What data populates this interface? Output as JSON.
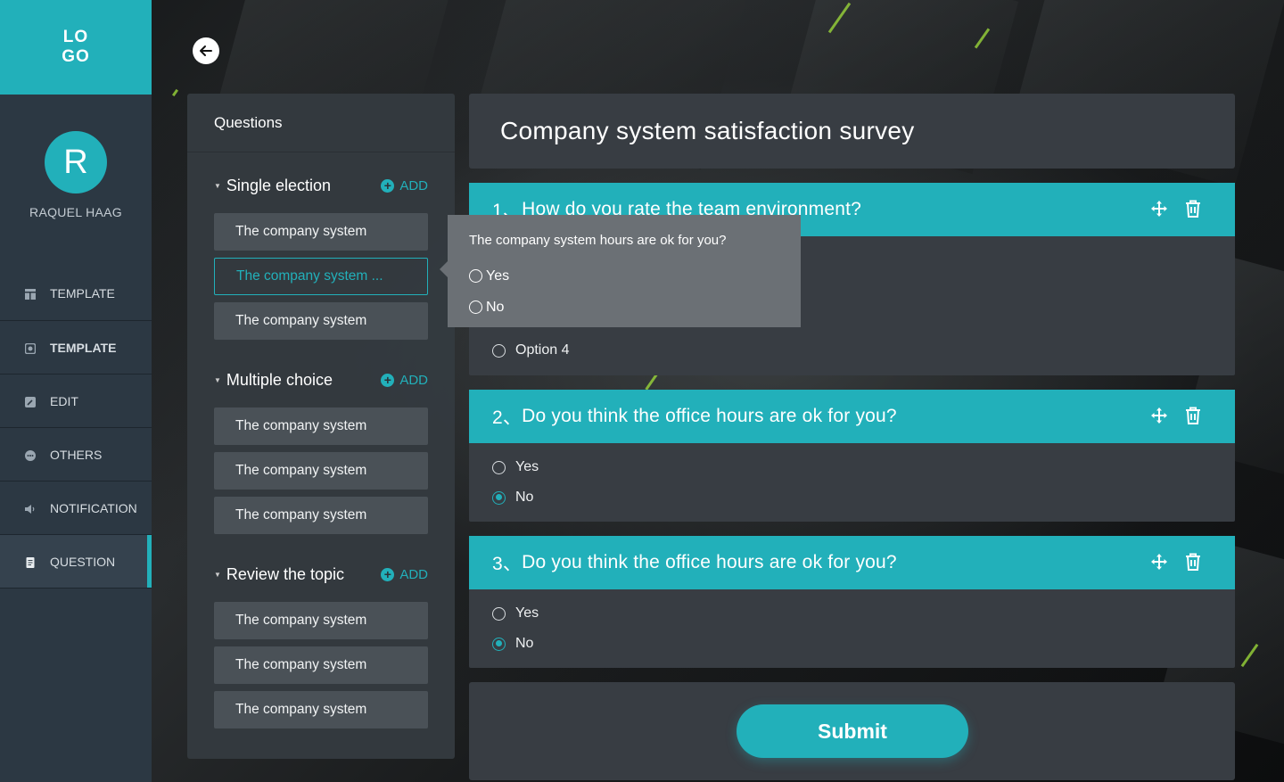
{
  "logo": {
    "text": "LO GO"
  },
  "user": {
    "initial": "R",
    "name": "RAQUEL HAAG"
  },
  "nav": [
    {
      "label": "TEMPLATE",
      "icon": "layout-icon",
      "bold": false,
      "active": false
    },
    {
      "label": "TEMPLATE",
      "icon": "template-icon",
      "bold": true,
      "active": false
    },
    {
      "label": "EDIT",
      "icon": "edit-icon",
      "bold": false,
      "active": false
    },
    {
      "label": "OTHERS",
      "icon": "others-icon",
      "bold": false,
      "active": false
    },
    {
      "label": "NOTIFICATION",
      "icon": "speaker-icon",
      "bold": false,
      "active": false
    },
    {
      "label": "QUESTION",
      "icon": "document-icon",
      "bold": false,
      "active": true
    }
  ],
  "questions_panel": {
    "title": "Questions",
    "add_label": "ADD",
    "groups": [
      {
        "title": "Single election",
        "items": [
          "The company system",
          "The company system ...",
          "The company system"
        ]
      },
      {
        "title": "Multiple choice",
        "items": [
          "The company system",
          "The company system",
          "The company system"
        ]
      },
      {
        "title": "Review the topic",
        "items": [
          "The company system",
          "The company system",
          "The company system"
        ]
      }
    ]
  },
  "popover": {
    "question": "The company system hours are ok for you?",
    "options": [
      "Yes",
      "No"
    ]
  },
  "survey": {
    "title": "Company system satisfaction survey",
    "questions": [
      {
        "number": "1、",
        "text": "How do you rate the team environment?",
        "options": [
          "Option 4"
        ],
        "selected": -1
      },
      {
        "number": "2、",
        "text": "Do you think the office hours are ok for you?",
        "options": [
          "Yes",
          "No"
        ],
        "selected": 1
      },
      {
        "number": "3、",
        "text": "Do you think the office hours are ok for you?",
        "options": [
          "Yes",
          "No"
        ],
        "selected": 1
      }
    ],
    "submit_label": "Submit"
  },
  "colors": {
    "accent": "#22b0ba",
    "sidebar": "#2c3843",
    "card": "#383d43"
  }
}
